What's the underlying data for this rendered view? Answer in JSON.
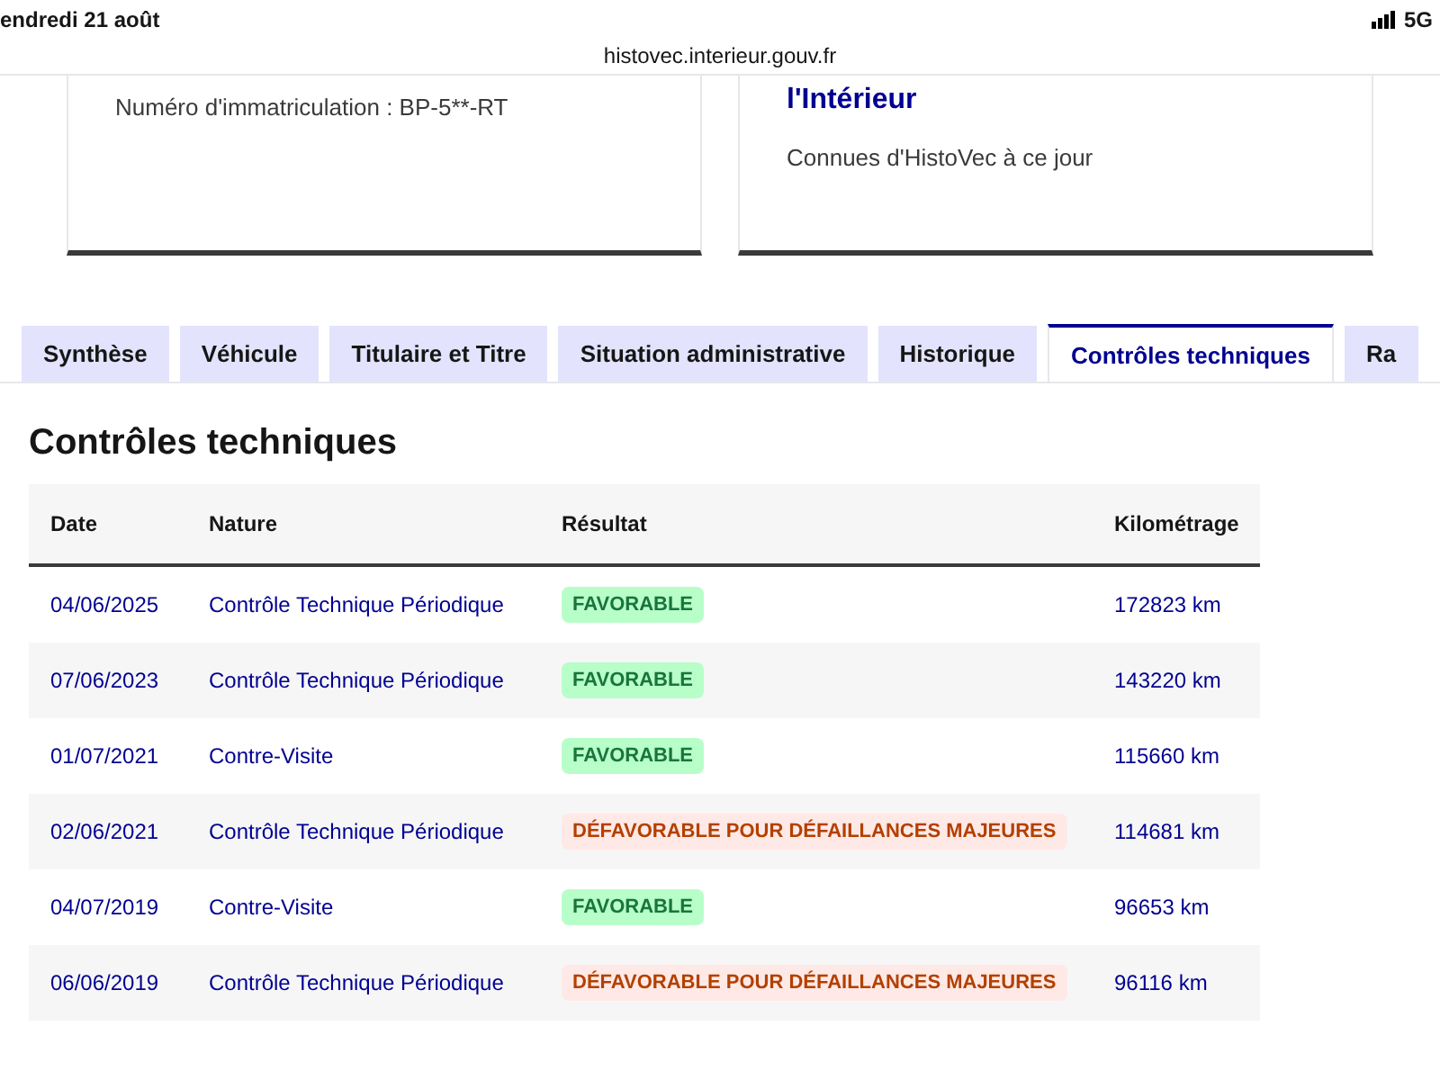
{
  "status_bar": {
    "date": "endredi 21 août",
    "network": "5G"
  },
  "address_bar": {
    "url": "histovec.interieur.gouv.fr"
  },
  "cards": [
    {
      "text": "Numéro d'immatriculation : BP-5**-RT"
    },
    {
      "title": "l'Intérieur",
      "text": "Connues d'HistoVec à ce jour"
    }
  ],
  "tabs": [
    {
      "label": "Synthèse",
      "selected": false
    },
    {
      "label": "Véhicule",
      "selected": false
    },
    {
      "label": "Titulaire et Titre",
      "selected": false
    },
    {
      "label": "Situation administrative",
      "selected": false
    },
    {
      "label": "Historique",
      "selected": false
    },
    {
      "label": "Contrôles techniques",
      "selected": true
    },
    {
      "label": "Ra",
      "selected": false
    }
  ],
  "section": {
    "title": "Contrôles techniques"
  },
  "table": {
    "columns": [
      "Date",
      "Nature",
      "Résultat",
      "Kilométrage"
    ],
    "rows": [
      {
        "date": "04/06/2025",
        "nature": "Contrôle Technique Périodique",
        "result": {
          "kind": "favorable",
          "text": "FAVORABLE"
        },
        "km": "172823 km"
      },
      {
        "date": "07/06/2023",
        "nature": "Contrôle Technique Périodique",
        "result": {
          "kind": "favorable",
          "text": "FAVORABLE"
        },
        "km": "143220 km"
      },
      {
        "date": "01/07/2021",
        "nature": "Contre-Visite",
        "result": {
          "kind": "favorable",
          "text": "FAVORABLE"
        },
        "km": "115660 km"
      },
      {
        "date": "02/06/2021",
        "nature": "Contrôle Technique Périodique",
        "result": {
          "kind": "unfavorable",
          "text": "DÉFAVORABLE POUR DÉFAILLANCES MAJEURES"
        },
        "km": "114681 km"
      },
      {
        "date": "04/07/2019",
        "nature": "Contre-Visite",
        "result": {
          "kind": "favorable",
          "text": "FAVORABLE"
        },
        "km": "96653 km"
      },
      {
        "date": "06/06/2019",
        "nature": "Contrôle Technique Périodique",
        "result": {
          "kind": "unfavorable",
          "text": "DÉFAVORABLE POUR DÉFAILLANCES MAJEURES"
        },
        "km": "96116 km"
      }
    ]
  }
}
